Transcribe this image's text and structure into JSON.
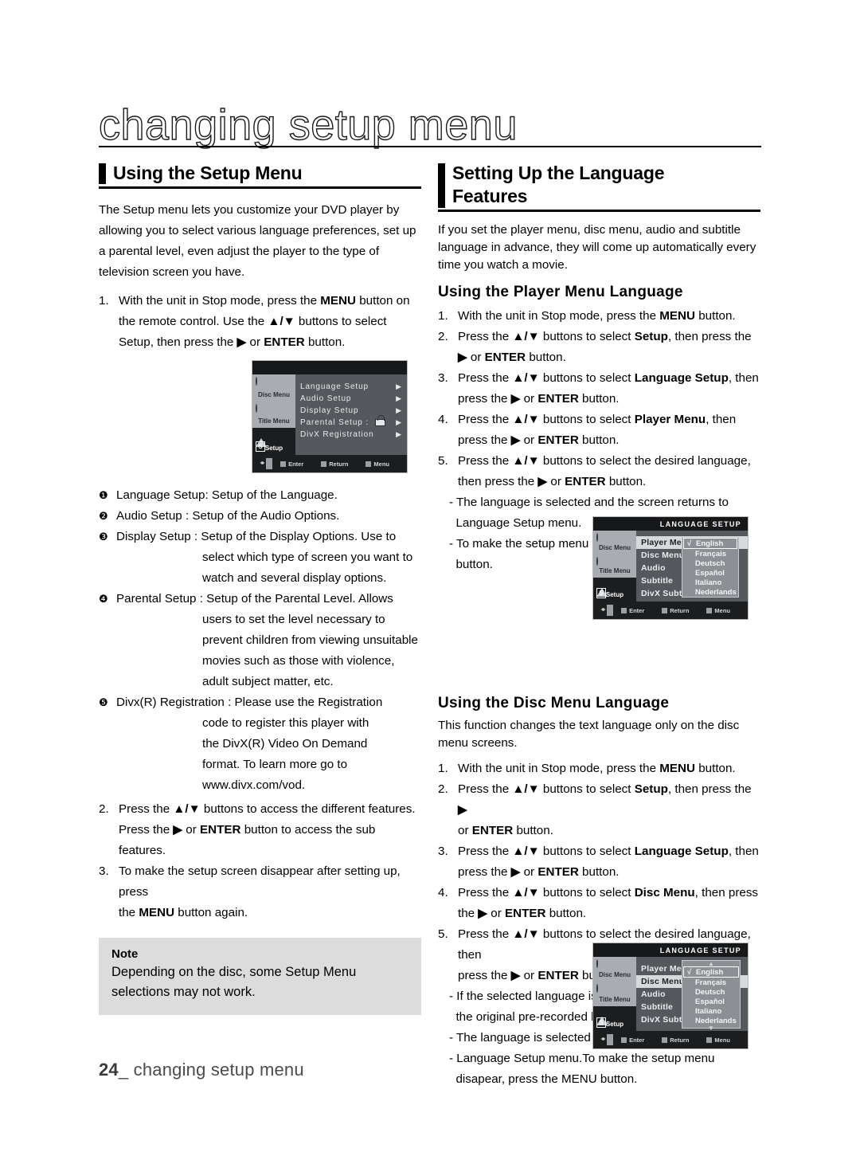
{
  "chapter_title": "changing setup menu",
  "footer": {
    "page_number": "24",
    "separator": "_",
    "text": "changing setup menu"
  },
  "left_column": {
    "heading": "Using the Setup Menu",
    "intro": "The Setup menu lets you customize your DVD player by allowing you to select various language preferences, set up a parental level, even adjust the player to the type of television screen you have.",
    "step1": {
      "num": "1.",
      "part_a": "With the unit in Stop mode, press the ",
      "bold_a": "MENU",
      "part_b": " button on the remote control.  Use the ",
      "arrows": "▲/▼",
      "part_c": " buttons to select Setup, then  press the ",
      "tri": "▶",
      "part_d": " or ",
      "bold_b": "ENTER",
      "part_e": " button."
    },
    "definitions": [
      {
        "marker": "❶",
        "title": "Language Setup: Setup of the Language.",
        "cont": []
      },
      {
        "marker": "❷",
        "title": "Audio Setup : Setup of the Audio Options.",
        "cont": []
      },
      {
        "marker": "❸",
        "title": "Display Setup : Setup of the Display Options. Use to",
        "cont": [
          "select which type of screen you want to",
          "watch and several display options."
        ]
      },
      {
        "marker": "❹",
        "title": "Parental Setup : Setup of the Parental Level. Allows",
        "cont": [
          "users to set the level necessary to",
          "prevent children from viewing unsuitable",
          "movies such as those with violence,",
          "adult subject matter, etc."
        ]
      },
      {
        "marker": "❺",
        "title": "Divx(R) Registration : Please use the Registration",
        "cont": [
          "code to register this player with",
          "the DivX(R) Video On Demand",
          "format. To learn more go to",
          "www.divx.com/vod."
        ]
      }
    ],
    "step2": {
      "num": "2.",
      "part_a": "Press the ",
      "arrows": "▲/▼",
      "part_b": " buttons to access the different  features.",
      "line2_a": "Press the ",
      "tri": "▶",
      "line2_b": " or ",
      "bold": "ENTER",
      "line2_c": " button to access the sub features."
    },
    "step3": {
      "num": "3.",
      "part_a": "To make the setup screen disappear after setting up, press",
      "line2_a": "the ",
      "bold": "MENU",
      "line2_b": " button again."
    },
    "note": {
      "title": "Note",
      "text": "Depending on the disc, some Setup Menu selections may not work."
    }
  },
  "right_column": {
    "heading_line1": "Setting Up the Language",
    "heading_line2": "Features",
    "intro": "If you set the player menu, disc menu, audio and subtitle language in advance, they will come up automatically every time you watch a movie.",
    "player_menu": {
      "heading": "Using the Player Menu Language",
      "steps": [
        {
          "num": "1.",
          "segs": [
            {
              "t": "With the unit in Stop mode, press the "
            },
            {
              "t": "MENU",
              "b": true
            },
            {
              "t": " button."
            }
          ]
        },
        {
          "num": "2.",
          "segs": [
            {
              "t": "Press the "
            },
            {
              "t": "▲/▼",
              "b": true
            },
            {
              "t": " buttons to select "
            },
            {
              "t": "Setup",
              "b": true
            },
            {
              "t": ", then press the"
            }
          ]
        },
        {
          "num": "",
          "segs": [
            {
              "t": "▶ ",
              "b": true
            },
            {
              "t": "or "
            },
            {
              "t": "ENTER",
              "b": true
            },
            {
              "t": " button."
            }
          ]
        },
        {
          "num": "3.",
          "segs": [
            {
              "t": "Press the "
            },
            {
              "t": "▲/▼",
              "b": true
            },
            {
              "t": " buttons to select "
            },
            {
              "t": "Language Setup",
              "b": true
            },
            {
              "t": ", then"
            }
          ]
        },
        {
          "num": "",
          "segs": [
            {
              "t": "press the "
            },
            {
              "t": "▶",
              "b": true
            },
            {
              "t": " or "
            },
            {
              "t": "ENTER",
              "b": true
            },
            {
              "t": " button."
            }
          ]
        },
        {
          "num": "4.",
          "segs": [
            {
              "t": "Press the "
            },
            {
              "t": "▲/▼",
              "b": true
            },
            {
              "t": " buttons to select "
            },
            {
              "t": "Player Menu",
              "b": true
            },
            {
              "t": ", then"
            }
          ]
        },
        {
          "num": "",
          "segs": [
            {
              "t": "press the "
            },
            {
              "t": "▶",
              "b": true
            },
            {
              "t": " or "
            },
            {
              "t": "ENTER",
              "b": true
            },
            {
              "t": " button."
            }
          ]
        },
        {
          "num": "5.",
          "segs": [
            {
              "t": "Press the "
            },
            {
              "t": "▲/▼",
              "b": true
            },
            {
              "t": " buttons to select the desired language,"
            }
          ]
        },
        {
          "num": "",
          "segs": [
            {
              "t": "then press the "
            },
            {
              "t": "▶",
              "b": true
            },
            {
              "t": " or "
            },
            {
              "t": "ENTER",
              "b": true
            },
            {
              "t": " button."
            }
          ]
        }
      ],
      "bullets": [
        "- The language is selected and the screen returns to",
        "  Language Setup menu.",
        "- To make the setup menu disappear, press the MENU",
        "  button."
      ]
    },
    "disc_menu": {
      "heading": "Using the Disc Menu Language",
      "intro": "This function changes the text language only on the disc menu screens.",
      "steps": [
        {
          "num": "1.",
          "segs": [
            {
              "t": "With the unit in Stop mode, press the "
            },
            {
              "t": "MENU",
              "b": true
            },
            {
              "t": " button."
            }
          ]
        },
        {
          "num": "2.",
          "segs": [
            {
              "t": "Press the "
            },
            {
              "t": "▲/▼",
              "b": true
            },
            {
              "t": " buttons to select "
            },
            {
              "t": "Setup",
              "b": true
            },
            {
              "t": ", then press the "
            },
            {
              "t": "▶",
              "b": true
            }
          ]
        },
        {
          "num": "",
          "segs": [
            {
              "t": "or "
            },
            {
              "t": "ENTER",
              "b": true
            },
            {
              "t": " button."
            }
          ]
        },
        {
          "num": "3.",
          "segs": [
            {
              "t": "Press the "
            },
            {
              "t": "▲/▼",
              "b": true
            },
            {
              "t": " buttons to select "
            },
            {
              "t": "Language Setup",
              "b": true
            },
            {
              "t": ", then"
            }
          ]
        },
        {
          "num": "",
          "segs": [
            {
              "t": "press the "
            },
            {
              "t": "▶",
              "b": true
            },
            {
              "t": " or "
            },
            {
              "t": "ENTER",
              "b": true
            },
            {
              "t": " button."
            }
          ]
        },
        {
          "num": "4.",
          "segs": [
            {
              "t": "Press the  "
            },
            {
              "t": "▲/▼",
              "b": true
            },
            {
              "t": " buttons to select "
            },
            {
              "t": "Disc Menu",
              "b": true
            },
            {
              "t": ", then press"
            }
          ]
        },
        {
          "num": "",
          "segs": [
            {
              "t": "the "
            },
            {
              "t": "▶",
              "b": true
            },
            {
              "t": " or "
            },
            {
              "t": "ENTER",
              "b": true
            },
            {
              "t": "  button."
            }
          ]
        },
        {
          "num": "5.",
          "segs": [
            {
              "t": "Press the "
            },
            {
              "t": "▲/▼",
              "b": true
            },
            {
              "t": " buttons to select the desired language, then"
            }
          ]
        },
        {
          "num": "",
          "segs": [
            {
              "t": "press the "
            },
            {
              "t": "▶",
              "b": true
            },
            {
              "t": " or "
            },
            {
              "t": "ENTER",
              "b": true
            },
            {
              "t": " button."
            }
          ]
        }
      ],
      "bullets": [
        "- If the selected language is not recorded on  the disc,",
        "  the original pre-recorded language is selected.",
        "- The language is selected and the screen returns to",
        "- Language Setup menu.To make the setup menu",
        "  disapear, press the MENU button."
      ]
    }
  },
  "osd_setup": {
    "title": "",
    "tabs": [
      {
        "label": "Disc Menu",
        "icon": "disc-icon",
        "style": "light"
      },
      {
        "label": "Title Menu",
        "icon": "title-icon",
        "style": "light"
      },
      {
        "label": "Setup",
        "icon": "setup-icon",
        "style": "dark"
      }
    ],
    "items": [
      {
        "label": "Language Setup",
        "arrow": "▶"
      },
      {
        "label": "Audio Setup",
        "arrow": "▶"
      },
      {
        "label": "Display Setup",
        "arrow": "▶"
      },
      {
        "label": "Parental Setup :",
        "arrow": "▶",
        "lock": true
      },
      {
        "label": "DivX Registration",
        "arrow": "▶"
      }
    ],
    "footer": [
      {
        "label": "Enter"
      },
      {
        "label": "Return"
      },
      {
        "label": "Menu"
      }
    ]
  },
  "osd_player_menu": {
    "title": "LANGUAGE SETUP",
    "tabs": [
      {
        "label": "Disc Menu",
        "icon": "disc-icon",
        "style": "light"
      },
      {
        "label": "Title Menu",
        "icon": "title-icon",
        "style": "light"
      },
      {
        "label": "Setup",
        "icon": "setup-icon",
        "style": "dark"
      }
    ],
    "items": [
      {
        "label": "Player Menu",
        "selected": true
      },
      {
        "label": "Disc Menu",
        "selected": false
      },
      {
        "label": "Audio",
        "selected": false
      },
      {
        "label": "Subtitle",
        "selected": false
      },
      {
        "label": "DivX Subtitle",
        "selected": false
      }
    ],
    "languages": [
      {
        "label": "English",
        "selected": true,
        "check": "√"
      },
      {
        "label": "Français",
        "selected": false
      },
      {
        "label": "Deutsch",
        "selected": false
      },
      {
        "label": "Español",
        "selected": false
      },
      {
        "label": "Italiano",
        "selected": false
      },
      {
        "label": "Nederlands",
        "selected": false
      }
    ],
    "scroll_up": "",
    "scroll_down": "",
    "footer": [
      {
        "label": "Enter"
      },
      {
        "label": "Return"
      },
      {
        "label": "Menu"
      }
    ]
  },
  "osd_disc_menu": {
    "title": "LANGUAGE SETUP",
    "tabs": [
      {
        "label": "Disc Menu",
        "icon": "disc-icon",
        "style": "light"
      },
      {
        "label": "Title Menu",
        "icon": "title-icon",
        "style": "light"
      },
      {
        "label": "Setup",
        "icon": "setup-icon",
        "style": "dark"
      }
    ],
    "items": [
      {
        "label": "Player Menu",
        "selected": false
      },
      {
        "label": "Disc Menu",
        "selected": true
      },
      {
        "label": "Audio",
        "selected": false
      },
      {
        "label": "Subtitle",
        "selected": false
      },
      {
        "label": "DivX Subtitle",
        "selected": false
      }
    ],
    "languages": [
      {
        "label": "English",
        "selected": true,
        "check": "√"
      },
      {
        "label": "Français",
        "selected": false
      },
      {
        "label": "Deutsch",
        "selected": false
      },
      {
        "label": "Español",
        "selected": false
      },
      {
        "label": "Italiano",
        "selected": false
      },
      {
        "label": "Nederlands",
        "selected": false
      }
    ],
    "scroll_up": "▲",
    "scroll_down": "▼",
    "footer": [
      {
        "label": "Enter"
      },
      {
        "label": "Return"
      },
      {
        "label": "Menu"
      }
    ]
  }
}
